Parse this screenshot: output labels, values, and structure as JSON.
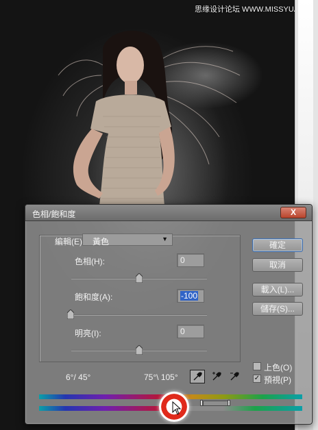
{
  "watermark": "思缘设计论坛 WWW.MISSYUAN.COM",
  "dialog": {
    "title": "色相/飽和度",
    "close_label": "X",
    "edit_label": "編輯(E):",
    "edit_value": "黃色",
    "hue_label": "色相(H):",
    "hue_value": "0",
    "saturation_label": "飽和度(A):",
    "saturation_value": "-100",
    "lightness_label": "明亮(I):",
    "lightness_value": "0",
    "range_left": "6°/ 45°",
    "range_right": "75°\\ 105°",
    "buttons": {
      "ok": "確定",
      "cancel": "取消",
      "load": "載入(L)...",
      "save": "儲存(S)..."
    },
    "colorize_label": "上色(O)",
    "colorize_checked": false,
    "preview_label": "預視(P)",
    "preview_checked": true,
    "hue_level": 0,
    "saturation_level": -100,
    "lightness_level": 0
  },
  "colors": {
    "selection": "#3164c7",
    "close_button": "#c0523b",
    "cursor_highlight": "#e02a1b"
  },
  "icons": [
    "eyedropper-icon",
    "eyedropper-plus-icon",
    "eyedropper-minus-icon",
    "cursor-arrow-icon",
    "dropdown-arrow-icon",
    "checkmark-icon"
  ]
}
